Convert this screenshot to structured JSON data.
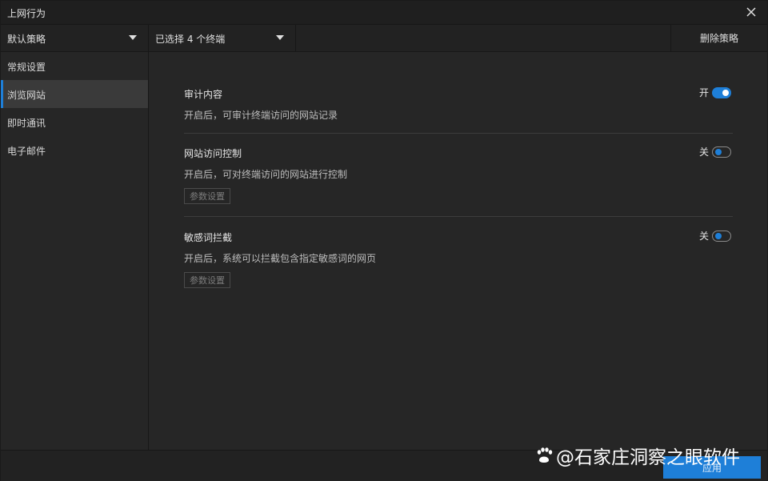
{
  "window": {
    "title": "上网行为"
  },
  "toolbar": {
    "policy_dropdown": "默认策略",
    "terminal_dropdown": "已选择 4 个终端",
    "delete_label": "删除策略"
  },
  "sidebar": {
    "items": [
      {
        "label": "常规设置"
      },
      {
        "label": "浏览网站"
      },
      {
        "label": "即时通讯"
      },
      {
        "label": "电子邮件"
      }
    ],
    "active_index": 1
  },
  "sections": [
    {
      "title": "审计内容",
      "desc": "开启后，可审计终端访问的网站记录",
      "switch_label": "开",
      "enabled": true
    },
    {
      "title": "网站访问控制",
      "desc": "开启后，可对终端访问的网站进行控制",
      "param_label": "参数设置",
      "switch_label": "关",
      "enabled": false
    },
    {
      "title": "敏感词拦截",
      "desc": "开启后，系统可以拦截包含指定敏感词的网页",
      "param_label": "参数设置",
      "switch_label": "关",
      "enabled": false
    }
  ],
  "footer": {
    "apply_label": "应用"
  },
  "watermark": {
    "text": "@石家庄洞察之眼软件"
  },
  "colors": {
    "accent": "#1e7fd8",
    "background": "#262626"
  }
}
